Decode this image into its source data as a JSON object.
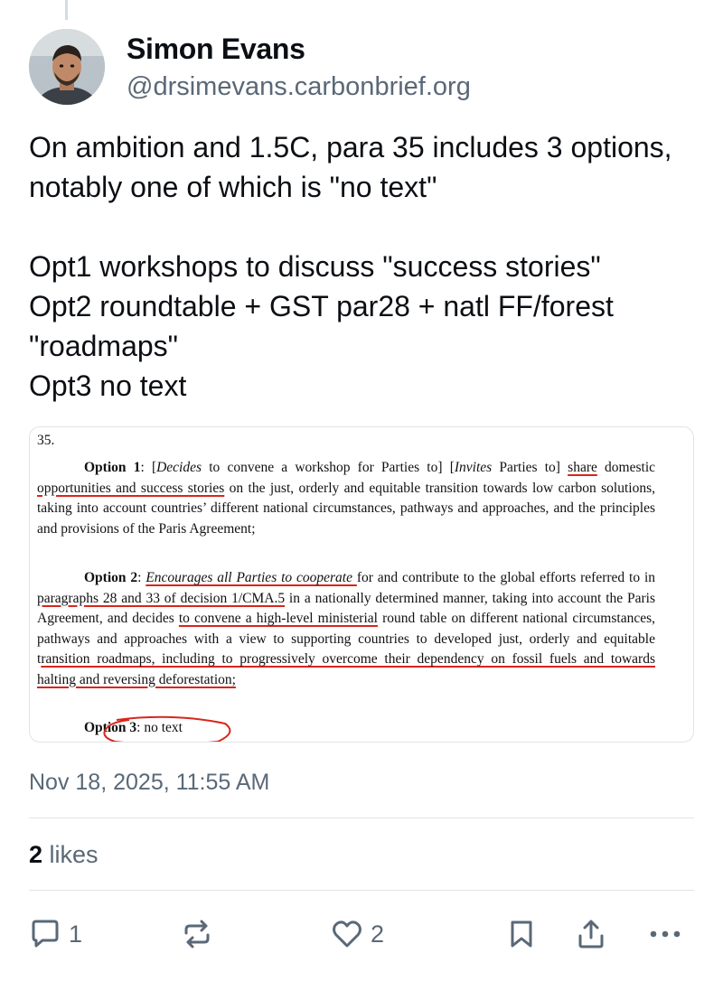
{
  "post": {
    "author_name": "Simon Evans",
    "author_handle": "@drsimevans.carbonbrief.org",
    "text": "On ambition and 1.5C, para 35 includes 3 options, notably one of which is \"no text\"\n\nOpt1 workshops to discuss \"success stories\"\nOpt2 roundtable + GST par28 + natl FF/forest \"roadmaps\"\nOpt3 no text",
    "timestamp": "Nov 18, 2025, 11:55 AM",
    "likes_count": "2",
    "likes_label": "likes"
  },
  "embed_doc": {
    "para_number": "35.",
    "option1": {
      "label": "Option 1",
      "seg1": ": [",
      "seg2": "Decides",
      "seg3": " to convene a workshop for Parties to] [",
      "seg4": "Invites",
      "seg5": " Parties to] ",
      "ul1": "share",
      "seg6": " domestic ",
      "ul2": "opportunities and success stories",
      "seg7": " on the just, orderly and equitable transition towards low carbon solutions, taking into account countries’ different national circumstances, pathways and approaches, and the principles and provisions of the Paris Agreement;"
    },
    "option2": {
      "label": "Option 2",
      "seg1": ": ",
      "ul1": "Encourages all Parties to cooperate ",
      "seg2": "for and contribute to the global efforts referred to in ",
      "ul2": "paragraphs 28 and 33 of decision 1/CMA.5",
      "seg3": " in a nationally determined manner, taking into account the Paris Agreement, and decides ",
      "ul3": "to convene a high-level ministerial",
      "seg4": " round table on different national circumstances, pathways and approaches with a view to supporting countries to developed just, orderly and equitable t",
      "ul4": "ransition roadmaps, including to progressively overcome their dependency on fossil fuels and towards halting and reversing deforestation;"
    },
    "option3": {
      "label": "Option 3",
      "text": ": no text"
    }
  },
  "actions": {
    "reply_count": "1",
    "like_count": "2"
  },
  "colors": {
    "accent_red": "#d8261c",
    "muted_text": "#5a6877",
    "divider": "#dfe4e9"
  }
}
